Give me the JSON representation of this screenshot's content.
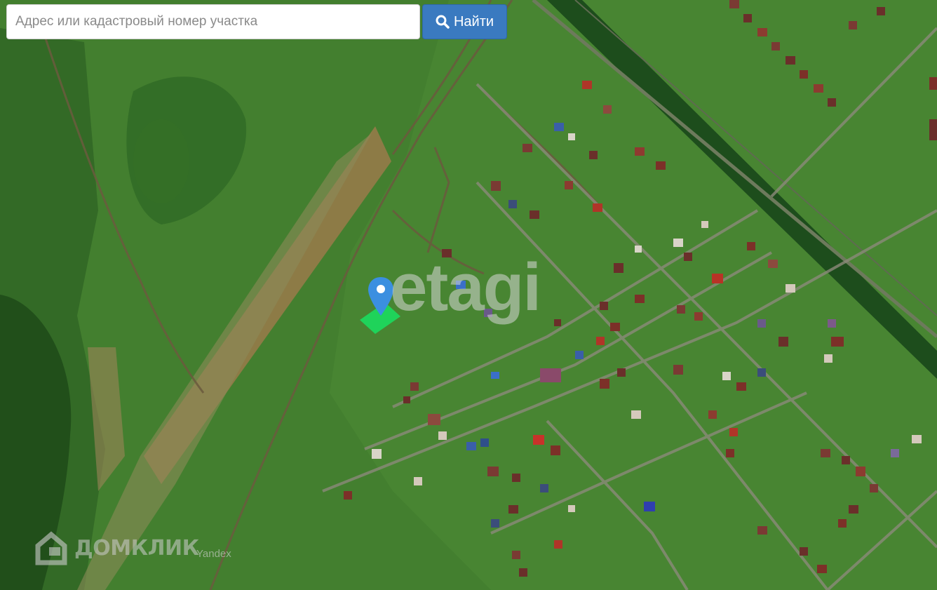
{
  "search": {
    "placeholder": "Адрес или кадастровый номер участка",
    "button_label": "Найти",
    "button_icon": "search-icon"
  },
  "map": {
    "watermark": "etagi",
    "logo": "ДОМКЛИК",
    "attribution": "Yandex",
    "marker_icon": "map-pin-icon",
    "plot_color": "#1fd35a",
    "marker_color": "#3b8fe0"
  }
}
